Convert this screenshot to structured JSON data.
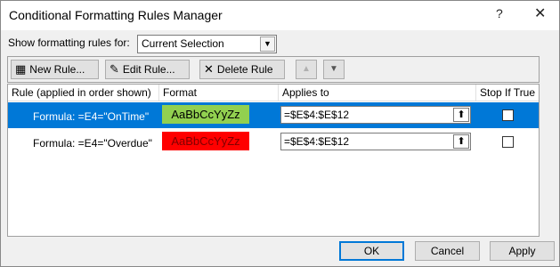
{
  "window": {
    "title": "Conditional Formatting Rules Manager",
    "help": "?",
    "close": "✕"
  },
  "filter": {
    "label": "Show formatting rules for:",
    "selected": "Current Selection"
  },
  "toolbar": {
    "new_label": "New Rule...",
    "edit_label": "Edit Rule...",
    "delete_label": "Delete Rule"
  },
  "columns": {
    "rule": "Rule (applied in order shown)",
    "format": "Format",
    "applies": "Applies to",
    "stop": "Stop If True"
  },
  "rules": [
    {
      "rule": "Formula: =E4=\"OnTime\"",
      "preview": "AaBbCcYyZz",
      "preview_bg": "#92d050",
      "preview_color": "#000000",
      "applies_to": "=$E$4:$E$12",
      "stop_if_true": false,
      "selected": true
    },
    {
      "rule": "Formula: =E4=\"Overdue\"",
      "preview": "AaBbCcYyZz",
      "preview_bg": "#ff0000",
      "preview_color": "#7f0000",
      "applies_to": "=$E$4:$E$12",
      "stop_if_true": false,
      "selected": false
    }
  ],
  "buttons": {
    "ok": "OK",
    "cancel": "Cancel",
    "apply": "Apply"
  },
  "colors": {
    "selection": "#0078d7"
  }
}
